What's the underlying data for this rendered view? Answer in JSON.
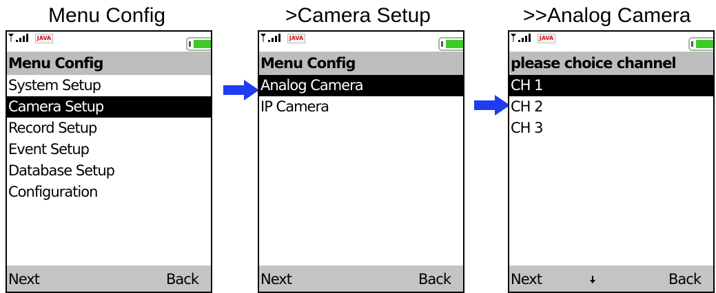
{
  "captions": [
    "Menu Config",
    ">Camera Setup",
    ">>Analog Camera"
  ],
  "status": {
    "java_badge": "JAVA"
  },
  "screens": [
    {
      "title": "Menu Config",
      "items": [
        "System Setup",
        "Camera Setup",
        "Record Setup",
        "Event Setup",
        "Database Setup",
        "Configuration"
      ],
      "selected_index": 1,
      "softkeys": {
        "left": "Next",
        "right": "Back"
      }
    },
    {
      "title": "Menu Config",
      "items": [
        "Analog Camera",
        "IP Camera"
      ],
      "selected_index": 0,
      "softkeys": {
        "left": "Next",
        "right": "Back"
      }
    },
    {
      "title": "please choice channel",
      "items": [
        "CH 1",
        "CH 2",
        "CH 3"
      ],
      "selected_index": 0,
      "softkeys": {
        "left": "Next",
        "right": "Back"
      },
      "scroll_indicator": "down-arrow-icon"
    }
  ],
  "colors": {
    "title_bar": "#bdbdbd",
    "soft_bar": "#c4c4c4",
    "selection": "#000000",
    "pointer_arrow": "#1e3cf0",
    "battery_fill": "#3fca2a",
    "java_text": "#d01818"
  }
}
